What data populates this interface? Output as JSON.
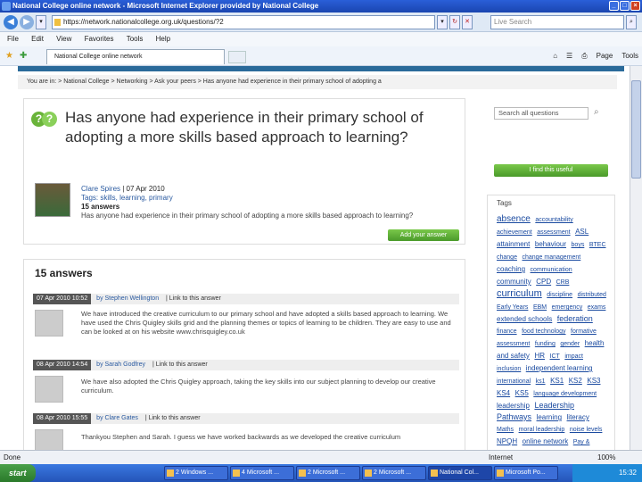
{
  "window": {
    "title": "National College online network - Microsoft Internet Explorer provided by National College"
  },
  "address": {
    "url": "https://network.nationalcollege.org.uk/questions/?2",
    "search_placeholder": "Live Search"
  },
  "menu": [
    "File",
    "Edit",
    "View",
    "Favorites",
    "Tools",
    "Help"
  ],
  "tab": {
    "label": "National College online network"
  },
  "commands": [
    "Page",
    "Tools"
  ],
  "breadcrumb": "You are in: > National College > Networking > Ask your peers > Has anyone had experience in their primary school of adopting a",
  "question": {
    "title": "Has anyone had experience in their primary school of adopting a more skills based approach to learning?",
    "author": "Clare Spires",
    "date": "07 Apr 2010",
    "tags": "Tags: skills, learning, primary",
    "answer_count": "15 answers",
    "summary": "Has anyone had experience in their primary school of adopting a more skills based approach to learning?",
    "add_answer": "Add your answer"
  },
  "answers": {
    "heading": "15 answers",
    "items": [
      {
        "date": "07 Apr 2010 10:52",
        "author": "by Stephen Wellington",
        "link": "| Link to this answer",
        "text": "We have introduced the creative curriculum to our primary school and have adopted a skills based approach to learning. We have used the Chris Quigley skills grid and the planning themes or topics of learning to be children. They are easy to use and can be looked at on his website www.chrisquigley.co.uk"
      },
      {
        "date": "08 Apr 2010 14:54",
        "author": "by Sarah Godfrey",
        "link": "| Link to this answer",
        "text": "We have also adopted the Chris Quigley approach, taking the key skills into our subject planning to develop our creative curriculum."
      },
      {
        "date": "08 Apr 2010 15:55",
        "author": "by Clare Gates",
        "link": "| Link to this answer",
        "text": "Thankyou Stephen and Sarah. I guess we have worked backwards as we developed the creative curriculum"
      }
    ]
  },
  "sidebar": {
    "search_placeholder": "Search all questions",
    "find_useful": "I find this useful",
    "tags_title": "Tags",
    "tags": [
      {
        "t": "absence",
        "s": 10
      },
      {
        "t": "accountability",
        "s": 7
      },
      {
        "t": "achievement",
        "s": 7
      },
      {
        "t": "assessment",
        "s": 7
      },
      {
        "t": "ASL",
        "s": 8
      },
      {
        "t": "attainment",
        "s": 8
      },
      {
        "t": "behaviour",
        "s": 8
      },
      {
        "t": "boys",
        "s": 7
      },
      {
        "t": "BTEC",
        "s": 7
      },
      {
        "t": "change",
        "s": 7
      },
      {
        "t": "change management",
        "s": 7
      },
      {
        "t": "coaching",
        "s": 8
      },
      {
        "t": "communication",
        "s": 7
      },
      {
        "t": "community",
        "s": 8
      },
      {
        "t": "CPD",
        "s": 8
      },
      {
        "t": "CRB",
        "s": 7
      },
      {
        "t": "curriculum",
        "s": 11
      },
      {
        "t": "discipline",
        "s": 7
      },
      {
        "t": "distributed",
        "s": 7
      },
      {
        "t": "Early Years",
        "s": 7
      },
      {
        "t": "EBM",
        "s": 7
      },
      {
        "t": "emergency",
        "s": 7
      },
      {
        "t": "exams",
        "s": 7
      },
      {
        "t": "extended schools",
        "s": 8
      },
      {
        "t": "federation",
        "s": 9
      },
      {
        "t": "finance",
        "s": 7
      },
      {
        "t": "food technology",
        "s": 7
      },
      {
        "t": "formative assessment",
        "s": 7
      },
      {
        "t": "funding",
        "s": 7
      },
      {
        "t": "gender",
        "s": 7
      },
      {
        "t": "health and safety",
        "s": 8
      },
      {
        "t": "HR",
        "s": 8
      },
      {
        "t": "ICT",
        "s": 7
      },
      {
        "t": "impact",
        "s": 7
      },
      {
        "t": "inclusion",
        "s": 7
      },
      {
        "t": "independent learning",
        "s": 8
      },
      {
        "t": "international",
        "s": 7
      },
      {
        "t": "ks1",
        "s": 7
      },
      {
        "t": "KS1",
        "s": 8
      },
      {
        "t": "KS2",
        "s": 8
      },
      {
        "t": "KS3",
        "s": 8
      },
      {
        "t": "KS4",
        "s": 8
      },
      {
        "t": "KS5",
        "s": 8
      },
      {
        "t": "language development",
        "s": 7
      },
      {
        "t": "leadership",
        "s": 8
      },
      {
        "t": "Leadership Pathways",
        "s": 9
      },
      {
        "t": "learning",
        "s": 8
      },
      {
        "t": "literacy",
        "s": 8
      },
      {
        "t": "Maths",
        "s": 7
      },
      {
        "t": "moral leadership",
        "s": 7
      },
      {
        "t": "noise levels",
        "s": 7
      },
      {
        "t": "NPQH",
        "s": 8
      },
      {
        "t": "online network",
        "s": 8
      },
      {
        "t": "Pay & Pensions",
        "s": 7
      }
    ]
  },
  "status": {
    "left": "Done",
    "zone": "Internet",
    "zoom": "100%"
  },
  "taskbar": {
    "start": "start",
    "buttons": [
      "2 Windows ...",
      "4 Microsoft ...",
      "2 Microsoft ...",
      "2 Microsoft ...",
      "National Col...",
      "Microsoft Po..."
    ],
    "clock": "15:32"
  }
}
